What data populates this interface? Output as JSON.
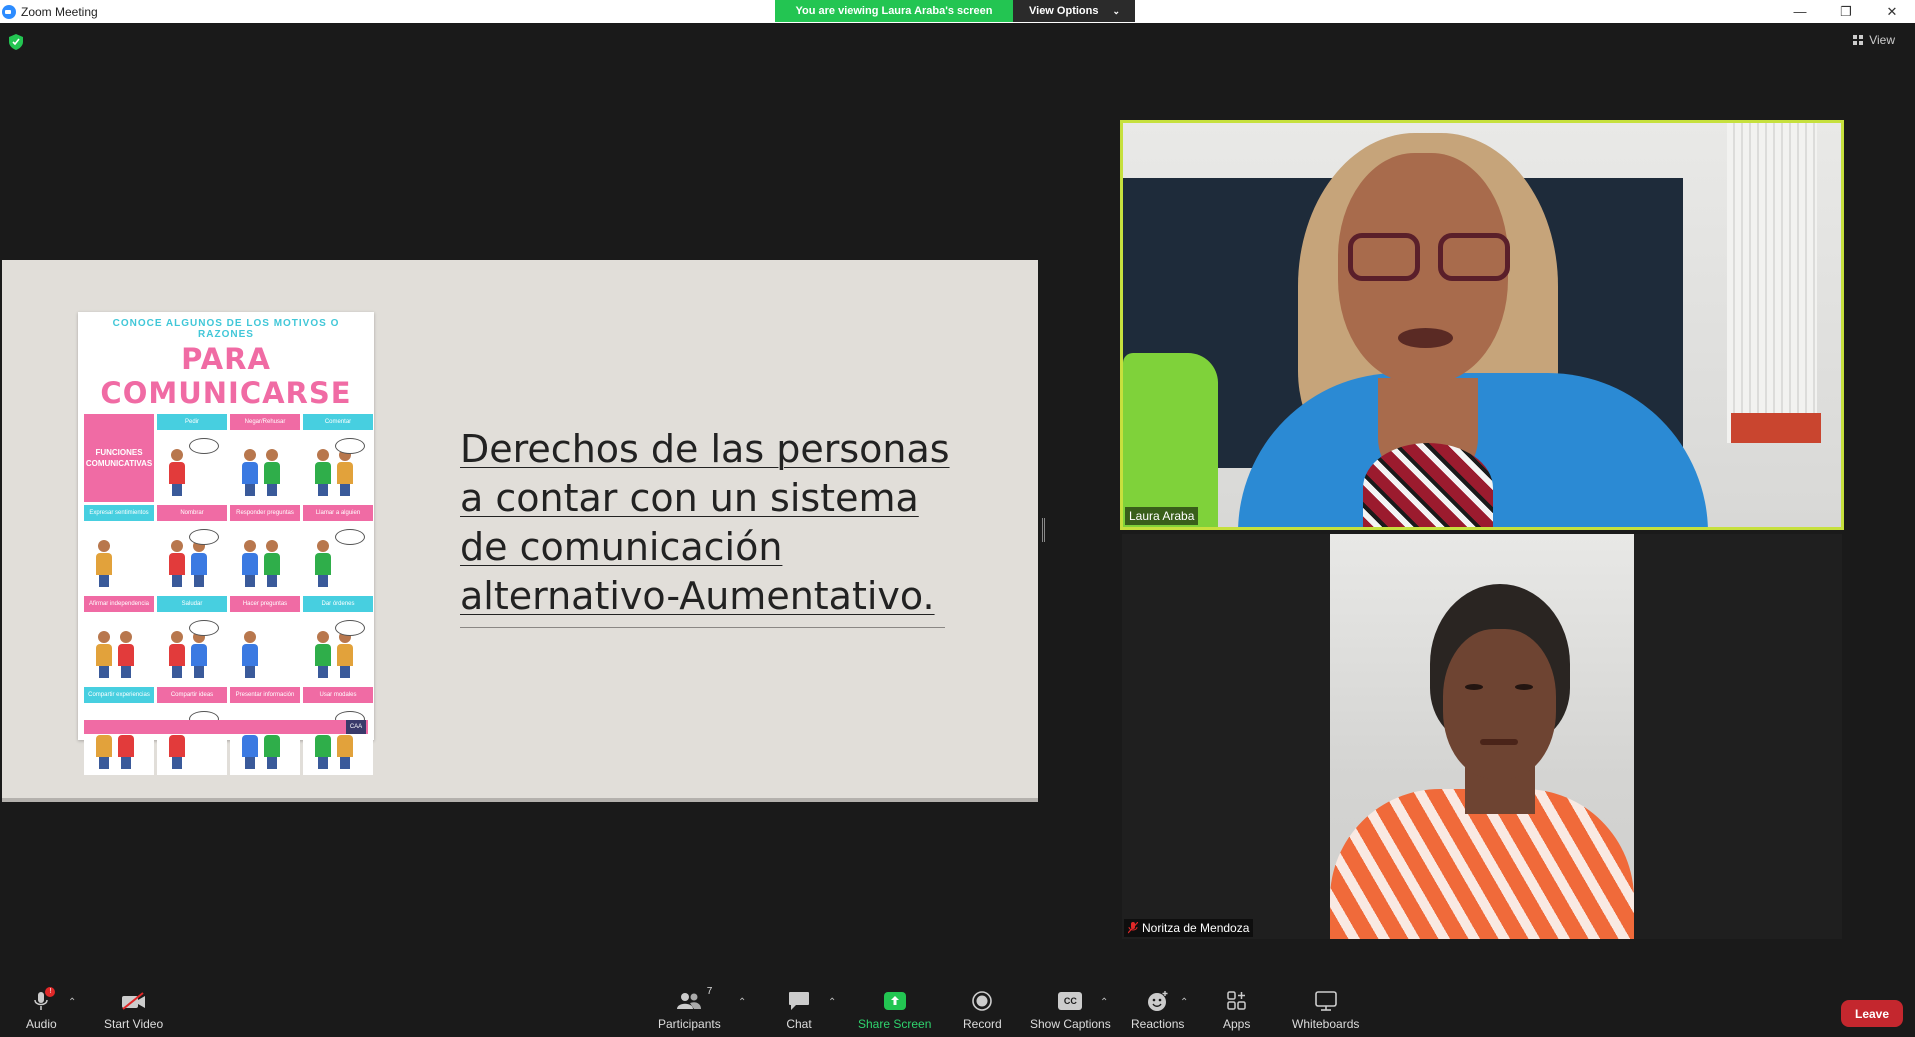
{
  "window": {
    "title": "Zoom Meeting"
  },
  "banner": {
    "viewing_text": "You are viewing Laura Araba's screen",
    "view_options": "View Options"
  },
  "top_right": {
    "view_label": "View"
  },
  "slide": {
    "heading": "Derechos de las personas a contar con un sistema de comunicación alternativo-Aumentativo.",
    "poster": {
      "subtitle": "CONOCE ALGUNOS DE LOS MOTIVOS O RAZONES",
      "title": "PARA COMUNICARSE",
      "functions_label": "FUNCIONES COMUNICATIVAS",
      "cells": [
        {
          "label": "Pedir",
          "color": "cyan"
        },
        {
          "label": "Negar/Rehusar",
          "color": "pink"
        },
        {
          "label": "Comentar",
          "color": "cyan"
        },
        {
          "label": "Expresar sentimientos",
          "color": "cyan"
        },
        {
          "label": "Nombrar",
          "color": "pink"
        },
        {
          "label": "Responder preguntas",
          "color": "pink"
        },
        {
          "label": "Llamar a alguien",
          "color": "pink"
        },
        {
          "label": "Afirmar independencia",
          "color": "pink"
        },
        {
          "label": "Saludar",
          "color": "cyan"
        },
        {
          "label": "Hacer preguntas",
          "color": "pink"
        },
        {
          "label": "Dar órdenes",
          "color": "cyan"
        },
        {
          "label": "Compartir experiencias",
          "color": "cyan"
        },
        {
          "label": "Compartir ideas",
          "color": "pink"
        },
        {
          "label": "Presentar información",
          "color": "pink"
        },
        {
          "label": "Usar modales",
          "color": "pink"
        }
      ],
      "footer_logo": "CAA"
    }
  },
  "participants": {
    "speaker": {
      "name": "Laura Araba"
    },
    "other": {
      "name": "Noritza de Mendoza"
    }
  },
  "toolbar": {
    "audio": "Audio",
    "start_video": "Start Video",
    "participants": "Participants",
    "participants_count": "7",
    "chat": "Chat",
    "share_screen": "Share Screen",
    "record": "Record",
    "show_captions": "Show Captions",
    "captions_icon_text": "CC",
    "reactions": "Reactions",
    "apps": "Apps",
    "whiteboards": "Whiteboards",
    "leave": "Leave"
  },
  "colors": {
    "share_green": "#23c552",
    "active_speaker_border": "#c6e03d",
    "leave_red": "#c4272e"
  }
}
